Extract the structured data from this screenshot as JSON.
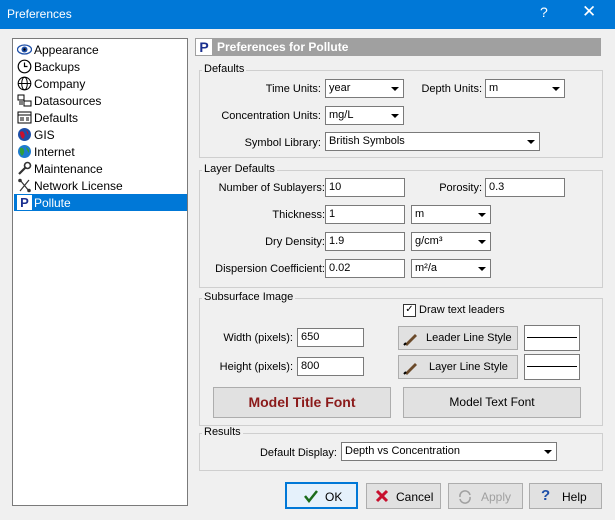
{
  "window": {
    "title": "Preferences",
    "help_glyph": "?",
    "close_glyph": "✕"
  },
  "nav": {
    "items": [
      {
        "label": "Appearance",
        "icon": "eye-icon"
      },
      {
        "label": "Backups",
        "icon": "clock-icon"
      },
      {
        "label": "Company",
        "icon": "globe-icon"
      },
      {
        "label": "Datasources",
        "icon": "datasource-icon"
      },
      {
        "label": "Defaults",
        "icon": "defaults-icon"
      },
      {
        "label": "GIS",
        "icon": "gis-globe-icon"
      },
      {
        "label": "Internet",
        "icon": "internet-globe-icon"
      },
      {
        "label": "Maintenance",
        "icon": "wrench-icon"
      },
      {
        "label": "Network License",
        "icon": "network-icon"
      },
      {
        "label": "Pollute",
        "icon": "pollute-icon",
        "selected": true
      }
    ]
  },
  "panel": {
    "header_icon_letter": "P",
    "title": "Preferences for Pollute"
  },
  "defaults": {
    "group_label": "Defaults",
    "time_units_label": "Time Units:",
    "time_units_value": "year",
    "depth_units_label": "Depth Units:",
    "depth_units_value": "m",
    "conc_units_label": "Concentration Units:",
    "conc_units_value": "mg/L",
    "symbol_library_label": "Symbol Library:",
    "symbol_library_value": "British Symbols"
  },
  "layer_defaults": {
    "group_label": "Layer Defaults",
    "sublayers_label": "Number of Sublayers:",
    "sublayers_value": "10",
    "porosity_label": "Porosity:",
    "porosity_value": "0.3",
    "thickness_label": "Thickness:",
    "thickness_value": "1",
    "thickness_unit": "m",
    "dry_density_label": "Dry Density:",
    "dry_density_value": "1.9",
    "dry_density_unit": "g/cm³",
    "dispersion_label": "Dispersion Coefficient:",
    "dispersion_value": "0.02",
    "dispersion_unit": "m²/a"
  },
  "subsurface": {
    "group_label": "Subsurface Image",
    "draw_text_leaders_label": "Draw text leaders",
    "draw_text_leaders_checked": true,
    "width_label": "Width (pixels):",
    "width_value": "650",
    "height_label": "Height (pixels):",
    "height_value": "800",
    "leader_line_style_label": "Leader Line Style",
    "layer_line_style_label": "Layer Line Style",
    "model_title_font_label": "Model Title Font",
    "model_text_font_label": "Model Text Font",
    "title_font_color": "#8b1a1a"
  },
  "results": {
    "group_label": "Results",
    "default_display_label": "Default Display:",
    "default_display_value": "Depth vs Concentration"
  },
  "buttons": {
    "ok": "OK",
    "cancel": "Cancel",
    "apply": "Apply",
    "help": "Help"
  },
  "colors": {
    "titlebar": "#0078d7",
    "selection": "#0078d7",
    "header_bar": "#a0a0a0",
    "cancel_x": "#c8102e",
    "ok_check": "#1a6b1a"
  }
}
